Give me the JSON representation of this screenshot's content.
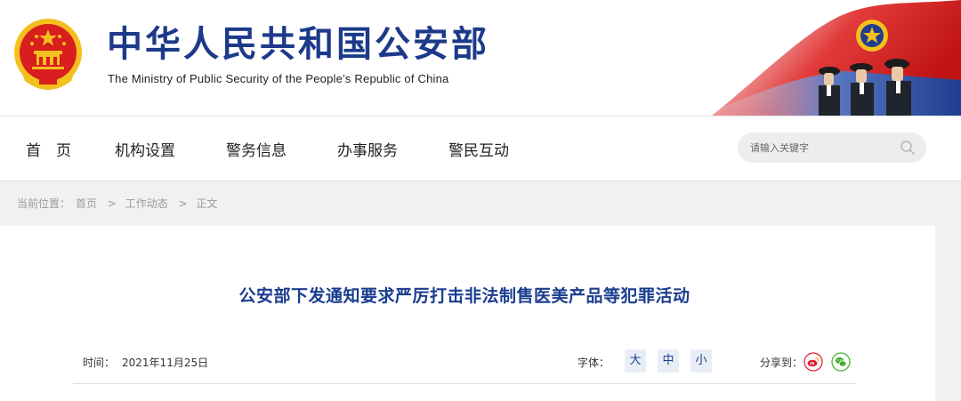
{
  "site": {
    "title": "中华人民共和国公安部",
    "subtitle": "The Ministry of Public Security of the People’s Republic of China"
  },
  "nav": {
    "items": [
      "首　页",
      "机构设置",
      "警务信息",
      "办事服务",
      "警民互动"
    ]
  },
  "search": {
    "placeholder": "请输入关键字",
    "icon": "search-icon"
  },
  "breadcrumb": {
    "prefix": "当前位置：",
    "items": [
      "首页",
      "工作动态",
      "正文"
    ],
    "separator": ">"
  },
  "article": {
    "title": "公安部下发通知要求严厉打击非法制售医美产品等犯罪活动",
    "time_label": "时间：",
    "time_value": "2021年11月25日",
    "font_label": "字体：",
    "font_sizes": [
      "大",
      "中",
      "小"
    ],
    "share_label": "分享到：",
    "share_icons": [
      "weibo-icon",
      "wechat-icon"
    ]
  },
  "colors": {
    "brand_blue": "#1d3a8a",
    "title_blue": "#1a3d8f",
    "emblem_red": "#d81e1e",
    "emblem_gold": "#f4c01e",
    "weibo": "#e6162d",
    "wechat": "#3fae2a"
  }
}
